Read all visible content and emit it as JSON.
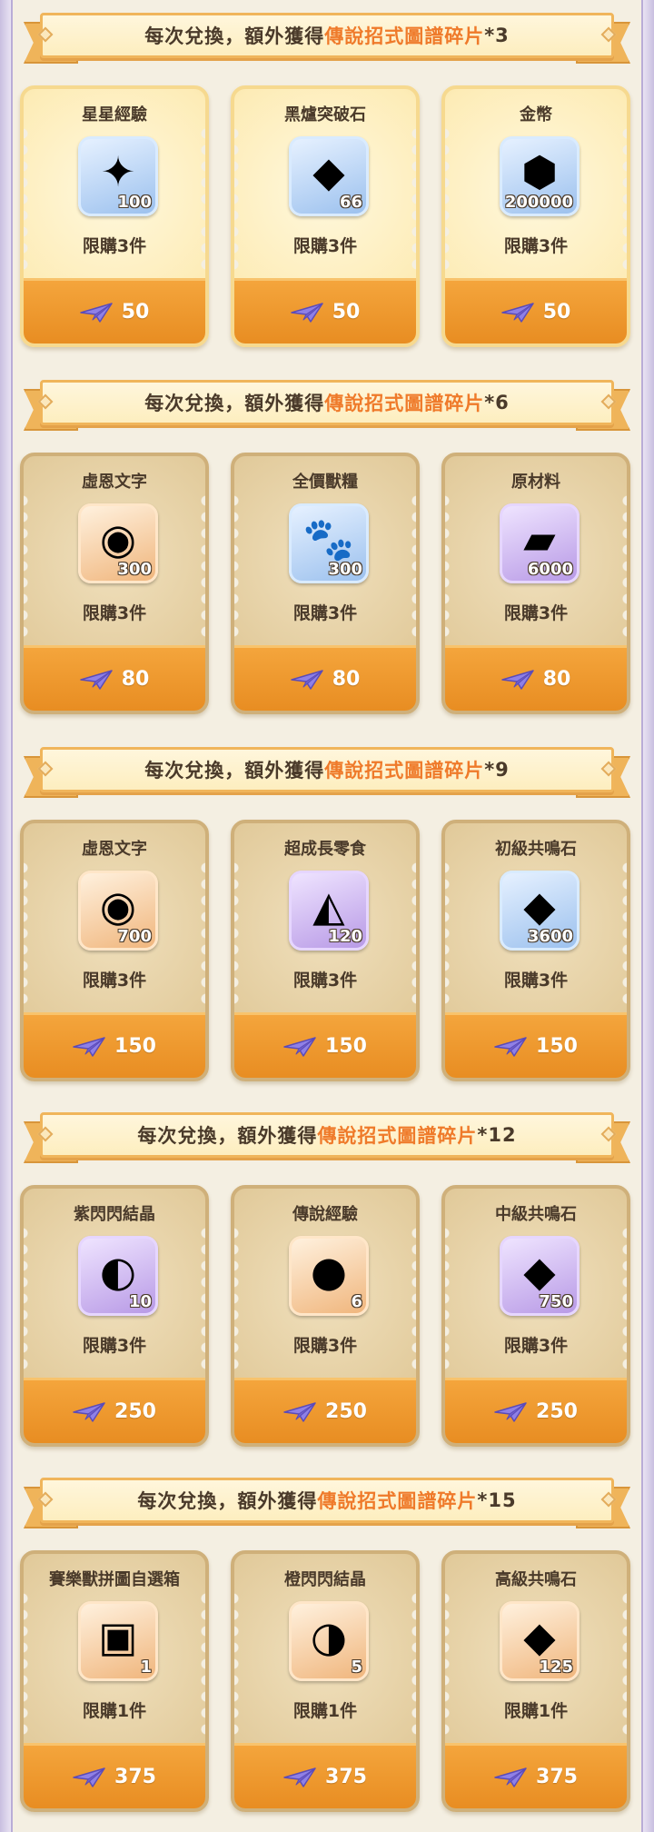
{
  "tiers": [
    {
      "banner": {
        "prefix": "每次兌換，額外獲得",
        "highlight": "傳說招式圖譜碎片",
        "suffix": "*3"
      },
      "style": "gold",
      "items": [
        {
          "name": "星星經驗",
          "qty": "100",
          "limit": "限購3件",
          "price": "50",
          "icon": "star-card-icon",
          "glyph": "✦",
          "box": "blue"
        },
        {
          "name": "黑爐突破石",
          "qty": "66",
          "limit": "限購3件",
          "price": "50",
          "icon": "black-ore-icon",
          "glyph": "◆",
          "box": "blue"
        },
        {
          "name": "金幣",
          "qty": "200000",
          "limit": "限購3件",
          "price": "50",
          "icon": "gold-coin-icon",
          "glyph": "⬢",
          "box": "blue"
        }
      ]
    },
    {
      "banner": {
        "prefix": "每次兌換，額外獲得",
        "highlight": "傳說招式圖譜碎片",
        "suffix": "*6"
      },
      "style": "tan",
      "items": [
        {
          "name": "虛恩文字",
          "qty": "300",
          "limit": "限購3件",
          "price": "80",
          "icon": "rune-orb-icon",
          "glyph": "◉",
          "box": "orange"
        },
        {
          "name": "全價獸糧",
          "qty": "300",
          "limit": "限購3件",
          "price": "80",
          "icon": "pet-food-bag-icon",
          "glyph": "🐾",
          "box": "blue"
        },
        {
          "name": "原材料",
          "qty": "6000",
          "limit": "限購3件",
          "price": "80",
          "icon": "metal-ingot-icon",
          "glyph": "▰",
          "box": "purple"
        }
      ]
    },
    {
      "banner": {
        "prefix": "每次兌換，額外獲得",
        "highlight": "傳說招式圖譜碎片",
        "suffix": "*9"
      },
      "style": "tan",
      "items": [
        {
          "name": "虛恩文字",
          "qty": "700",
          "limit": "限購3件",
          "price": "150",
          "icon": "rune-orb-icon",
          "glyph": "◉",
          "box": "orange"
        },
        {
          "name": "超成長零食",
          "qty": "120",
          "limit": "限購3件",
          "price": "150",
          "icon": "cheese-snack-icon",
          "glyph": "◭",
          "box": "purple"
        },
        {
          "name": "初級共鳴石",
          "qty": "3600",
          "limit": "限購3件",
          "price": "150",
          "icon": "blue-crystal-icon",
          "glyph": "◆",
          "box": "blue"
        }
      ]
    },
    {
      "banner": {
        "prefix": "每次兌換，額外獲得",
        "highlight": "傳說招式圖譜碎片",
        "suffix": "*12"
      },
      "style": "tan",
      "items": [
        {
          "name": "紫閃閃結晶",
          "qty": "10",
          "limit": "限購3件",
          "price": "250",
          "icon": "purple-cat-crystal-icon",
          "glyph": "◐",
          "box": "purple"
        },
        {
          "name": "傳說經驗",
          "qty": "6",
          "limit": "限購3件",
          "price": "250",
          "icon": "legend-exp-icon",
          "glyph": "●",
          "box": "orange"
        },
        {
          "name": "中級共鳴石",
          "qty": "750",
          "limit": "限購3件",
          "price": "250",
          "icon": "purple-crystal-icon",
          "glyph": "◆",
          "box": "purple"
        }
      ]
    },
    {
      "banner": {
        "prefix": "每次兌換，額外獲得",
        "highlight": "傳說招式圖譜碎片",
        "suffix": "*15"
      },
      "style": "tan",
      "items": [
        {
          "name": "賽樂獸拼圖自選箱",
          "qty": "1",
          "limit": "限購1件",
          "price": "375",
          "icon": "puzzle-chest-icon",
          "glyph": "▣",
          "box": "orange"
        },
        {
          "name": "橙閃閃結晶",
          "qty": "5",
          "limit": "限購1件",
          "price": "375",
          "icon": "orange-cat-crystal-icon",
          "glyph": "◑",
          "box": "orange"
        },
        {
          "name": "高級共鳴石",
          "qty": "125",
          "limit": "限購1件",
          "price": "375",
          "icon": "gold-crystal-icon",
          "glyph": "◆",
          "box": "orange"
        }
      ]
    }
  ],
  "colors": {
    "accent": "#ef7a2a",
    "price_bar": "#f0992e",
    "plane": "#7a6bd8"
  },
  "currency_icon": "paper-plane-icon"
}
